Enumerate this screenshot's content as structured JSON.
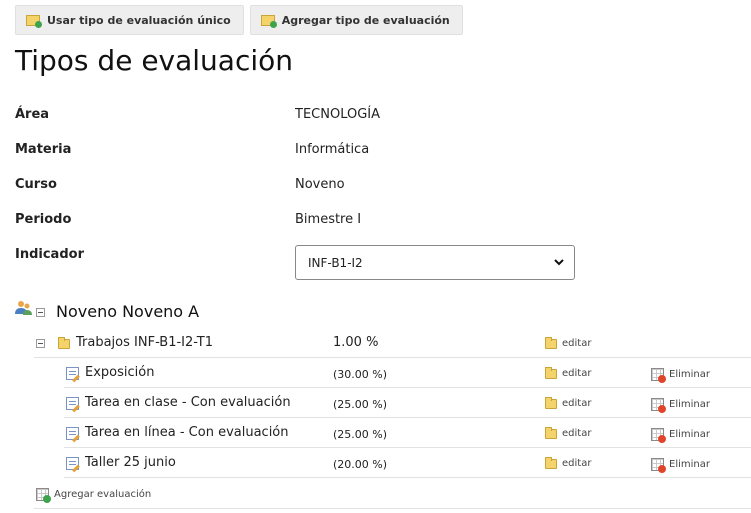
{
  "toolbar": {
    "btn_single_type": "Usar tipo de evaluación único",
    "btn_add_type": "Agregar tipo de evaluación"
  },
  "page_title": "Tipos de evaluación",
  "fields": {
    "area_label": "Área",
    "area_value": "TECNOLOGÍA",
    "materia_label": "Materia",
    "materia_value": "Informática",
    "curso_label": "Curso",
    "curso_value": "Noveno",
    "periodo_label": "Periodo",
    "periodo_value": "Bimestre I",
    "indicador_label": "Indicador",
    "indicador_value": "INF-B1-I2"
  },
  "tree": {
    "group_name": "Noveno Noveno A",
    "category": {
      "name": "Trabajos INF-B1-I2-T1",
      "percent": "1.00 %",
      "edit": "editar"
    },
    "items": [
      {
        "name": "Exposición",
        "percent": "(30.00 %)",
        "edit": "editar",
        "delete": "Eliminar"
      },
      {
        "name": "Tarea en clase - Con evaluación",
        "percent": "(25.00 %)",
        "edit": "editar",
        "delete": "Eliminar"
      },
      {
        "name": "Tarea en línea - Con evaluación",
        "percent": "(25.00 %)",
        "edit": "editar",
        "delete": "Eliminar"
      },
      {
        "name": "Taller 25 junio",
        "percent": "(20.00 %)",
        "edit": "editar",
        "delete": "Eliminar"
      }
    ],
    "add_evaluation": "Agregar evaluación"
  },
  "icons": {
    "folder": "folder-icon",
    "edit_doc": "edit-document-icon",
    "delete": "delete-grid-icon",
    "add": "add-grid-icon",
    "users": "users-icon",
    "collapse": "collapse-icon"
  },
  "colors": {
    "button_bg": "#eeeeee",
    "separator": "#e2e2e2",
    "folder": "#f4d36b"
  }
}
